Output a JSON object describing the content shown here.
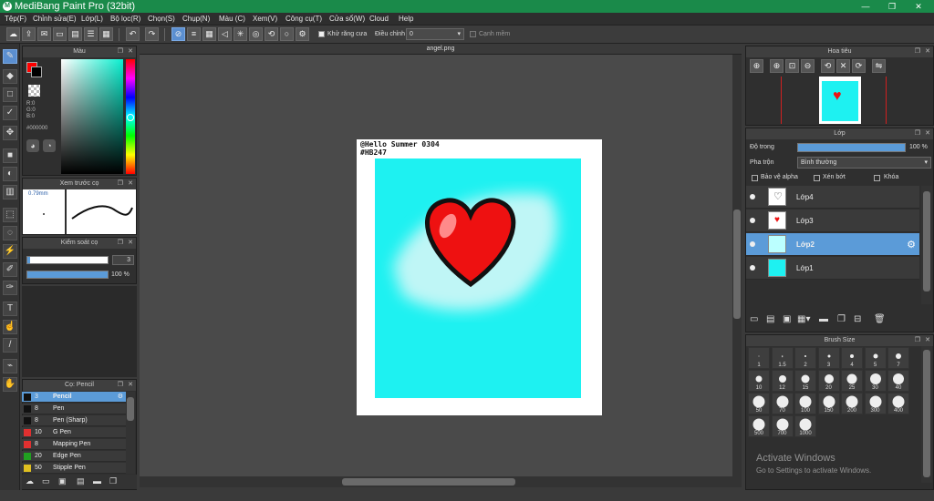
{
  "titlebar": {
    "title": "MediBang Paint Pro (32bit)",
    "minimize": "—",
    "restore": "❐",
    "close": "✕"
  },
  "menu": [
    "Tệp(F)",
    "Chỉnh sửa(E)",
    "Lớp(L)",
    "Bộ lọc(R)",
    "Chọn(S)",
    "Chụp(N)",
    "Màu (C)",
    "Xem(V)",
    "Công cụ(T)",
    "Cửa sổ(W)",
    "Cloud",
    "Help"
  ],
  "toolbar": {
    "antialias_label": "Khử răng cưa",
    "adjust_label": "Điều chỉnh",
    "adjust_value": "0",
    "smooth_label": "Cạnh mềm"
  },
  "color_panel": {
    "title": "Màu",
    "rgb": [
      "R:0",
      "G:0",
      "B:0"
    ],
    "hex": "#000000",
    "fg": "#ff0000",
    "bg": "#000000"
  },
  "brush_preview": {
    "title": "Xem trước cọ",
    "size": "0.79mm"
  },
  "brush_control": {
    "title": "Kiểm soát cọ",
    "size_value": "3",
    "opacity": "100 %"
  },
  "brush_list": {
    "title": "Cọ: Pencil",
    "items": [
      {
        "size": "3",
        "name": "Pencil",
        "color": "#111111"
      },
      {
        "size": "8",
        "name": "Pen",
        "color": "#111111"
      },
      {
        "size": "8",
        "name": "Pen (Sharp)",
        "color": "#111111"
      },
      {
        "size": "10",
        "name": "G Pen",
        "color": "#e03030"
      },
      {
        "size": "8",
        "name": "Mapping Pen",
        "color": "#e03030"
      },
      {
        "size": "20",
        "name": "Edge Pen",
        "color": "#20a020"
      },
      {
        "size": "50",
        "name": "Stipple Pen",
        "color": "#e0c020"
      }
    ]
  },
  "canvas": {
    "tab": "angel.png",
    "text_line1": "@Hello Summer 0304",
    "text_line2": "#HB247"
  },
  "navigator": {
    "title": "Hoa tiêu"
  },
  "layers": {
    "title": "Lớp",
    "opacity_label": "Độ trong",
    "opacity_value": "100 %",
    "blend_label": "Pha trộn",
    "blend_value": "Bình thường",
    "protect_alpha": "Bảo vệ alpha",
    "clipping": "Xén bớt",
    "lock": "Khóa",
    "items": [
      {
        "name": "Lớp4"
      },
      {
        "name": "Lớp3"
      },
      {
        "name": "Lớp2"
      },
      {
        "name": "Lớp1"
      }
    ]
  },
  "brush_size": {
    "title": "Brush Size",
    "sizes": [
      "1",
      "1.5",
      "2",
      "3",
      "4",
      "5",
      "7",
      "10",
      "12",
      "15",
      "20",
      "25",
      "30",
      "40",
      "50",
      "70",
      "100",
      "150",
      "200",
      "300",
      "400",
      "500",
      "700",
      "1000"
    ]
  },
  "watermark": {
    "line1": "Activate Windows",
    "line2": "Go to Settings to activate Windows."
  }
}
